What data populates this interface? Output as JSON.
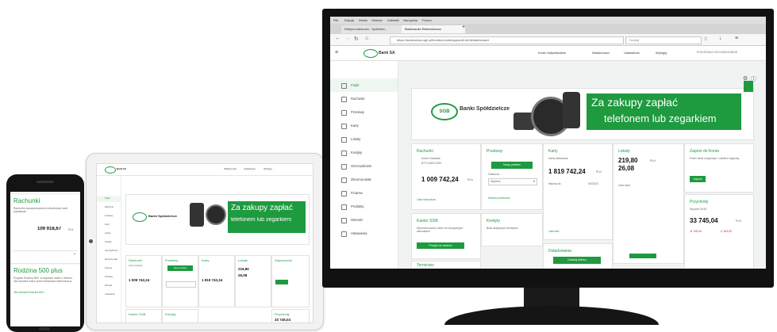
{
  "brand": {
    "name": "Bank SA",
    "logo_text": "SGB",
    "bank_group": "Banki Spółdzielcze",
    "accent": "#1e9a3f",
    "alert": "#c8102e"
  },
  "phone": {
    "accounts_title": "Rachunki",
    "accounts_desc": "Rachunek oszczędnościowo-rozliczeniowy osób prywatnych",
    "accounts_amount": "109 918,67",
    "accounts_currency": "PLN",
    "family_title": "Rodzina 500 plus",
    "family_desc": "Program Rodzina 500+ to wsparcie rodzin z dziećmi. Złóż wniosek online przez bankowość elektroniczną.",
    "family_link": "Złóż wniosek Rodzina 500+"
  },
  "banner": {
    "line1": "Za zakupy zapłać",
    "line2": "telefonem lub zegarkiem"
  },
  "monitor": {
    "menubar": [
      "Plik",
      "Edycja",
      "Widok",
      "Historia",
      "Zakładki",
      "Narzędzia",
      "Pomoc"
    ],
    "tabs": [
      "Witryna bankowa - Spółdziel...",
      "Bankowość Elektroniczna"
    ],
    "url": "https://bankowosc.sgb.pl/frontend-web/app/auth.html#/dashboard",
    "search_placeholder": "Szukaj",
    "header": {
      "user": "Konto Indywidualne",
      "messages": "Wiadomości",
      "settings": "Ustawienia",
      "logout": "Wyloguj",
      "session": "POZOSTAŁO DO KOŃCA SESJI"
    },
    "sidebar": [
      "Pulpit",
      "Rachunki",
      "Przelewy",
      "Karty",
      "Lokaty",
      "Kredyty",
      "Oszczędzanie",
      "Zlecenia stałe",
      "Finanse",
      "Produkty",
      "Wnioski",
      "Ustawienia"
    ],
    "cards": {
      "rachunki": {
        "title": "Rachunki",
        "account": "Konto Osobiste",
        "number": "8774 0000 2020",
        "amount": "1 009 742,24",
        "currency": "PLN",
        "link": "Lista rachunków"
      },
      "przelewy": {
        "title": "Przelewy",
        "button": "Nowy przelew",
        "select_label": "Odbiorca",
        "select_value": "Wybierz",
        "link": "Historia przelewów"
      },
      "karty": {
        "title": "Karty",
        "card_name": "Karta debetowa",
        "amount": "1 819 742,24",
        "currency": "PLN",
        "expiry_label": "Ważna do",
        "expiry": "06/2023",
        "link": "Lista kart"
      },
      "lokaty": {
        "title": "Lokaty",
        "amount1": "219,80",
        "amount2": "26,08",
        "currency": "PLN",
        "link": "Lista lokat"
      },
      "zaproszenie": {
        "title": "Zaproś do Konta",
        "desc": "Poleć bank znajomym i odbierz nagrodę",
        "button": "Zaproś"
      },
      "kantor": {
        "title": "Kantor SGB",
        "desc": "Wymiana walut online na korzystnych warunkach",
        "button": "Przejdź do kantora"
      },
      "kredyty": {
        "title": "Kredyty",
        "desc": "Brak aktywnych kredytów"
      },
      "doladowania": {
        "title": "Doładowania",
        "button": "Doładuj telefon"
      },
      "przychody": {
        "title": "Przychody",
        "period": "Styczeń 2019",
        "amount": "33 745,04",
        "currency": "PLN",
        "red1": "-8 745,04",
        "red2": "-2 103,20"
      },
      "terminarz": {
        "title": "Terminarz"
      }
    }
  },
  "tablet": {
    "cards": [
      "Rachunki",
      "Przelewy",
      "Karty",
      "Lokaty",
      "Zaproszenie"
    ],
    "amount": "1 009 742,24",
    "lokata_amount": "219,80",
    "lokata_amount2": "26,08",
    "karta_amount": "1 819 742,24",
    "przelew_button": "Nowy przelew",
    "bottom_cards": [
      "Kantor SGB",
      "Kredyty",
      "Przychody"
    ],
    "przychody_amount": "33 745,04"
  }
}
